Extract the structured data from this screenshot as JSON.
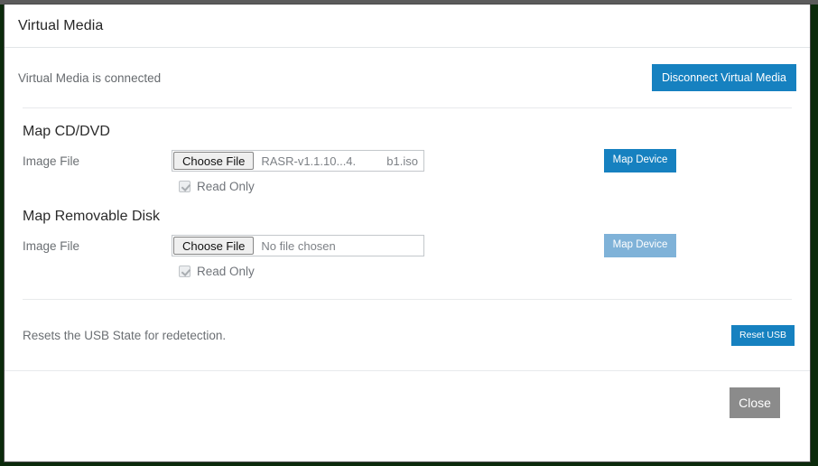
{
  "dialog": {
    "title": "Virtual Media"
  },
  "status": {
    "text": "Virtual Media is connected",
    "disconnect_label": "Disconnect Virtual Media"
  },
  "sections": [
    {
      "title": "Map CD/DVD",
      "field_label": "Image File",
      "choose_file_label": "Choose File",
      "file_name_primary": "RASR-v1.1.10...4.",
      "file_name_secondary": "b1.iso",
      "map_device_label": "Map Device",
      "map_device_enabled": true,
      "readonly_label": "Read Only",
      "readonly_checked": true
    },
    {
      "title": "Map Removable Disk",
      "field_label": "Image File",
      "choose_file_label": "Choose File",
      "file_name_primary": "No file chosen",
      "file_name_secondary": "",
      "map_device_label": "Map Device",
      "map_device_enabled": false,
      "readonly_label": "Read Only",
      "readonly_checked": true
    }
  ],
  "reset": {
    "text": "Resets the USB State for redetection.",
    "button_label": "Reset USB"
  },
  "footer": {
    "close_label": "Close"
  },
  "colors": {
    "primary_blue": "#1681c0",
    "disabled_blue": "#7fb2d8",
    "close_gray": "#8b8b8b",
    "backdrop_green": "#0b2a0b"
  }
}
